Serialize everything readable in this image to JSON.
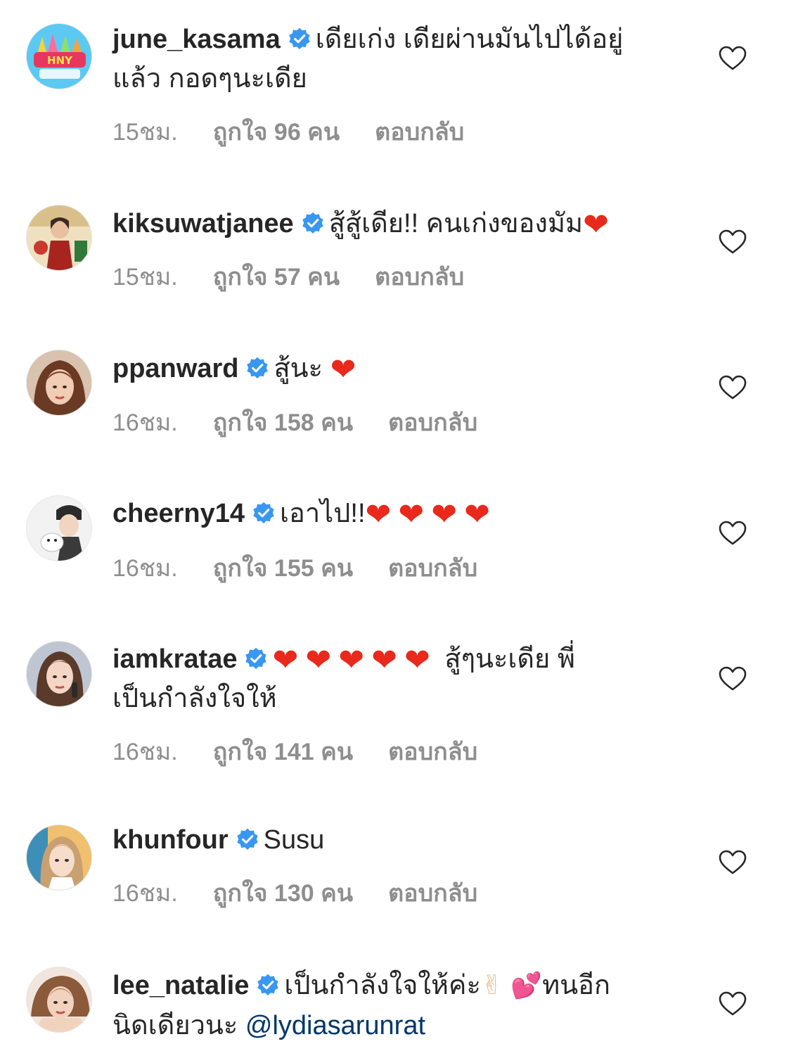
{
  "icons": {
    "verified": "verified-badge-icon",
    "like": "heart-outline-icon"
  },
  "colors": {
    "verified_blue": "#3897f0",
    "meta_gray": "#8e8e8e",
    "mention": "#00376b",
    "heart_red": "#e8291c"
  },
  "comments": [
    {
      "username": "june_kasama",
      "text_line1": "เดียเก่ง เดียผ่านมันไปได้อยู่",
      "text_line2": "แล้ว กอดๆนะเดีย",
      "time": "15ชม.",
      "likes": "ถูกใจ 96 คน",
      "reply": "ตอบกลับ"
    },
    {
      "username": "kiksuwatjanee",
      "text": "สู้สู้เดีย!! คนเก่งของมัม",
      "emoji": "❤",
      "time": "15ชม.",
      "likes": "ถูกใจ 57 คน",
      "reply": "ตอบกลับ"
    },
    {
      "username": "ppanward",
      "text": "สู้นะ",
      "emoji": "❤",
      "time": "16ชม.",
      "likes": "ถูกใจ 158 คน",
      "reply": "ตอบกลับ"
    },
    {
      "username": "cheerny14",
      "text": "เอาไป!!",
      "emoji": "❤❤❤❤",
      "time": "16ชม.",
      "likes": "ถูกใจ 155 คน",
      "reply": "ตอบกลับ"
    },
    {
      "username": "iamkratae",
      "emoji": "❤❤❤❤❤",
      "text_line1": "สู้ๆนะเดีย พี่",
      "text_line2": "เป็นกำลังใจให้",
      "time": "16ชม.",
      "likes": "ถูกใจ 141 คน",
      "reply": "ตอบกลับ"
    },
    {
      "username": "khunfour",
      "text": "Susu",
      "time": "16ชม.",
      "likes": "ถูกใจ 130 คน",
      "reply": "ตอบกลับ"
    },
    {
      "username": "lee_natalie",
      "text_line1": "เป็นกำลังใจให้ค่ะ",
      "emoji1": "✌",
      "emoji2": "💕",
      "text_line1b": "ทนอีก",
      "text_line2": "นิดเดียวนะ",
      "mention": "@lydiasarunrat"
    }
  ]
}
